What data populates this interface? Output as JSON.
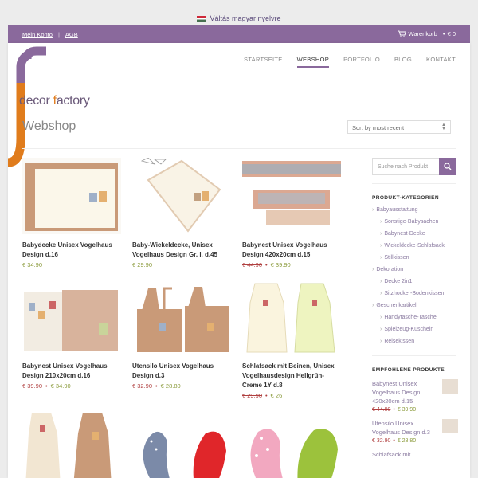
{
  "langbar": {
    "text": "Váltás magyar nyelvre"
  },
  "topbar": {
    "account": "Mein Konto",
    "agb": "AGB",
    "cart": "Warenkorb",
    "cart_total": "€ 0"
  },
  "nav": {
    "items": [
      "STARTSEITE",
      "WEBSHOP",
      "PORTFOLIO",
      "BLOG",
      "KONTAKT"
    ]
  },
  "logo": {
    "part1": "decor ",
    "part2": "f",
    "part3": "actory"
  },
  "page": {
    "title": "Webshop"
  },
  "sort": {
    "value": "Sort by most recent"
  },
  "products": [
    {
      "name": "Babydecke Unisex Vogelhaus Design d.16",
      "old_price": "",
      "price": "€ 34.90"
    },
    {
      "name": "Baby-Wickeldecke, Unisex Vogelhaus Design Gr. l. d.45",
      "old_price": "",
      "price": "€ 29.90"
    },
    {
      "name": "Babynest Unisex Vogelhaus Design 420x20cm d.15",
      "old_price": "€ 44.90",
      "price": "€ 39.90"
    },
    {
      "name": "Babynest Unisex Vogelhaus Design 210x20cm d.16",
      "old_price": "€ 39.90",
      "price": "€ 34.90"
    },
    {
      "name": "Utensilo Unisex Vogelhaus Design d.3",
      "old_price": "€ 32.90",
      "price": "€ 28.80"
    },
    {
      "name": "Schlafsack mit Beinen, Unisex Vogelhausdesign Hellgrün-Creme 1Y d.8",
      "old_price": "€ 29.90",
      "price": "€ 26"
    },
    {
      "name": "",
      "old_price": "",
      "price": ""
    },
    {
      "name": "",
      "old_price": "",
      "price": ""
    },
    {
      "name": "",
      "old_price": "",
      "price": ""
    }
  ],
  "sidebar": {
    "search_placeholder": "Suche nach Produkt",
    "categories_title": "PRODUKT-KATEGORIEN",
    "categories": [
      {
        "label": "Babyausstattung",
        "sub": false
      },
      {
        "label": "Sonstige-Babysachen",
        "sub": true
      },
      {
        "label": "Babynest-Decke",
        "sub": true
      },
      {
        "label": "Wickeldecke-Schlafsack",
        "sub": true
      },
      {
        "label": "Stillkissen",
        "sub": true
      },
      {
        "label": "Dekoration",
        "sub": false
      },
      {
        "label": "Decke 2in1",
        "sub": true
      },
      {
        "label": "Sitzhocker-Bodenkissen",
        "sub": true
      },
      {
        "label": "Geschenkartikel",
        "sub": false
      },
      {
        "label": "Handytasche-Tasche",
        "sub": true
      },
      {
        "label": "Spielzeug-Kuscheln",
        "sub": true
      },
      {
        "label": "Reisekissen",
        "sub": true
      }
    ],
    "featured_title": "EMPFOHLENE PRODUKTE",
    "featured": [
      {
        "name": "Babynest Unisex Vogelhaus Design 420x20cm d.15",
        "old_price": "€ 44.90",
        "price": "€ 39.90"
      },
      {
        "name": "Utensilo Unisex Vogelhaus Design d.3",
        "old_price": "€ 32.90",
        "price": "€ 28.80"
      },
      {
        "name": "Schlafsack mit",
        "old_price": "",
        "price": ""
      }
    ]
  },
  "colors": {
    "accent": "#8a699c",
    "logo_orange": "#e07c1c",
    "sale": "#b04040",
    "price": "#8a9a3a"
  }
}
